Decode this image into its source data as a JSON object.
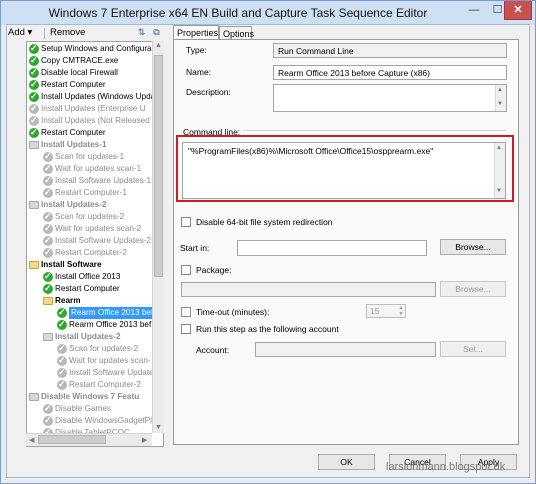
{
  "window": {
    "title": "Windows 7 Enterprise x64 EN Build and Capture Task Sequence Editor",
    "controls": {
      "minimize": "—",
      "maximize": "☐",
      "close": "✕"
    }
  },
  "toolbar": {
    "add_label": "Add ▾",
    "remove_label": "Remove",
    "icons": [
      "properties-icon",
      "copy-icon"
    ]
  },
  "tree": {
    "items": [
      {
        "label": "Setup Windows and Configura",
        "icon": "green-check-icon",
        "style": "normal",
        "indent": 0
      },
      {
        "label": "Copy CMTRACE.exe",
        "icon": "green-check-icon",
        "style": "normal",
        "indent": 0
      },
      {
        "label": "Disable local Firewall",
        "icon": "green-check-icon",
        "style": "normal",
        "indent": 0
      },
      {
        "label": "Restart Computer",
        "icon": "green-check-icon",
        "style": "normal",
        "indent": 0
      },
      {
        "label": "Install Updates (Windows Upda",
        "icon": "green-check-icon",
        "style": "normal",
        "indent": 0
      },
      {
        "label": "Install Updates (Enterprise U",
        "icon": "grey-check-icon",
        "style": "grey",
        "indent": 0
      },
      {
        "label": "Install Updates (Not Released",
        "icon": "grey-check-icon",
        "style": "grey",
        "indent": 0
      },
      {
        "label": "Restart Computer",
        "icon": "green-check-icon",
        "style": "normal",
        "indent": 0
      },
      {
        "label": "Install Updates-1",
        "icon": "grey-folder-icon",
        "style": "grey-bold",
        "indent": 0
      },
      {
        "label": "Scan for updates-1",
        "icon": "grey-check-icon",
        "style": "grey",
        "indent": 1
      },
      {
        "label": "Wait for updates scan-1",
        "icon": "grey-check-icon",
        "style": "grey",
        "indent": 1
      },
      {
        "label": "Install Software Updates-1",
        "icon": "grey-check-icon",
        "style": "grey",
        "indent": 1
      },
      {
        "label": "Restart Computer-1",
        "icon": "grey-check-icon",
        "style": "grey",
        "indent": 1
      },
      {
        "label": "Install Updates-2",
        "icon": "grey-folder-icon",
        "style": "grey-bold",
        "indent": 0
      },
      {
        "label": "Scan for updates-2",
        "icon": "grey-check-icon",
        "style": "grey",
        "indent": 1
      },
      {
        "label": "Wait for updates scan-2",
        "icon": "grey-check-icon",
        "style": "grey",
        "indent": 1
      },
      {
        "label": "Install Software Updates-2",
        "icon": "grey-check-icon",
        "style": "grey",
        "indent": 1
      },
      {
        "label": "Restart Computer-2",
        "icon": "grey-check-icon",
        "style": "grey",
        "indent": 1
      },
      {
        "label": "Install Software",
        "icon": "folder-icon",
        "style": "bold",
        "indent": 0
      },
      {
        "label": "Install Office 2013",
        "icon": "green-check-icon",
        "style": "normal",
        "indent": 1
      },
      {
        "label": "Restart Computer",
        "icon": "green-check-icon",
        "style": "normal",
        "indent": 1
      },
      {
        "label": "Rearm",
        "icon": "folder-icon",
        "style": "bold",
        "indent": 1
      },
      {
        "label": "Rearm Office 2013 bef",
        "icon": "green-check-icon",
        "style": "selected",
        "indent": 2
      },
      {
        "label": "Rearm Office 2013 bef",
        "icon": "green-check-icon",
        "style": "normal",
        "indent": 2
      },
      {
        "label": "Install Updates-2",
        "icon": "grey-folder-icon",
        "style": "grey-bold",
        "indent": 1
      },
      {
        "label": "Scan for updates-2",
        "icon": "grey-check-icon",
        "style": "grey",
        "indent": 2
      },
      {
        "label": "Wait for updates scan-",
        "icon": "grey-check-icon",
        "style": "grey",
        "indent": 2
      },
      {
        "label": "Install Software Update",
        "icon": "grey-check-icon",
        "style": "grey",
        "indent": 2
      },
      {
        "label": "Restart Computer-2",
        "icon": "grey-check-icon",
        "style": "grey",
        "indent": 2
      },
      {
        "label": "Disable Windows 7 Featu",
        "icon": "grey-folder-icon",
        "style": "grey-bold",
        "indent": 0
      },
      {
        "label": "Disable Games",
        "icon": "grey-check-icon",
        "style": "grey",
        "indent": 1
      },
      {
        "label": "Disable WindowsGadgetPl",
        "icon": "grey-check-icon",
        "style": "grey",
        "indent": 1
      },
      {
        "label": "Disable TabletPCOC",
        "icon": "grey-check-icon",
        "style": "grey",
        "indent": 1
      }
    ]
  },
  "tabs": [
    {
      "label": "Properties",
      "active": true
    },
    {
      "label": "Options",
      "active": false
    }
  ],
  "properties": {
    "type_label": "Type:",
    "type_value": "Run Command Line",
    "name_label": "Name:",
    "name_value": "Rearm Office 2013 before Capture (x86)",
    "description_label": "Description:",
    "description_value": "",
    "command_line_label": "Command line:",
    "command_line_value": "\"%ProgramFiles(x86)%\\Microsoft Office\\Office15\\ospprearm.exe\"",
    "disable_redirection_label": "Disable 64-bit file system redirection",
    "disable_redirection_checked": false,
    "start_in_label": "Start in:",
    "start_in_value": "",
    "browse_label": "Browse...",
    "package_label": "Package:",
    "package_checked": false,
    "package_value": "",
    "package_browse_label": "Browse...",
    "timeout_label": "Time-out (minutes):",
    "timeout_checked": false,
    "timeout_value": "15",
    "run_as_label": "Run this step as the following account",
    "run_as_checked": false,
    "account_label": "Account:",
    "account_value": "",
    "set_label": "Set..."
  },
  "footer": {
    "ok_label": "OK",
    "cancel_label": "Cancel",
    "apply_label": "Apply",
    "watermark": "larslohmann.blogspot.dk"
  },
  "colors": {
    "title_bar": "#cfe0f4",
    "close_button": "#c75050",
    "selection": "#3399ff",
    "success_check": "#2fa82f",
    "highlight_box": "#c81e1e"
  }
}
